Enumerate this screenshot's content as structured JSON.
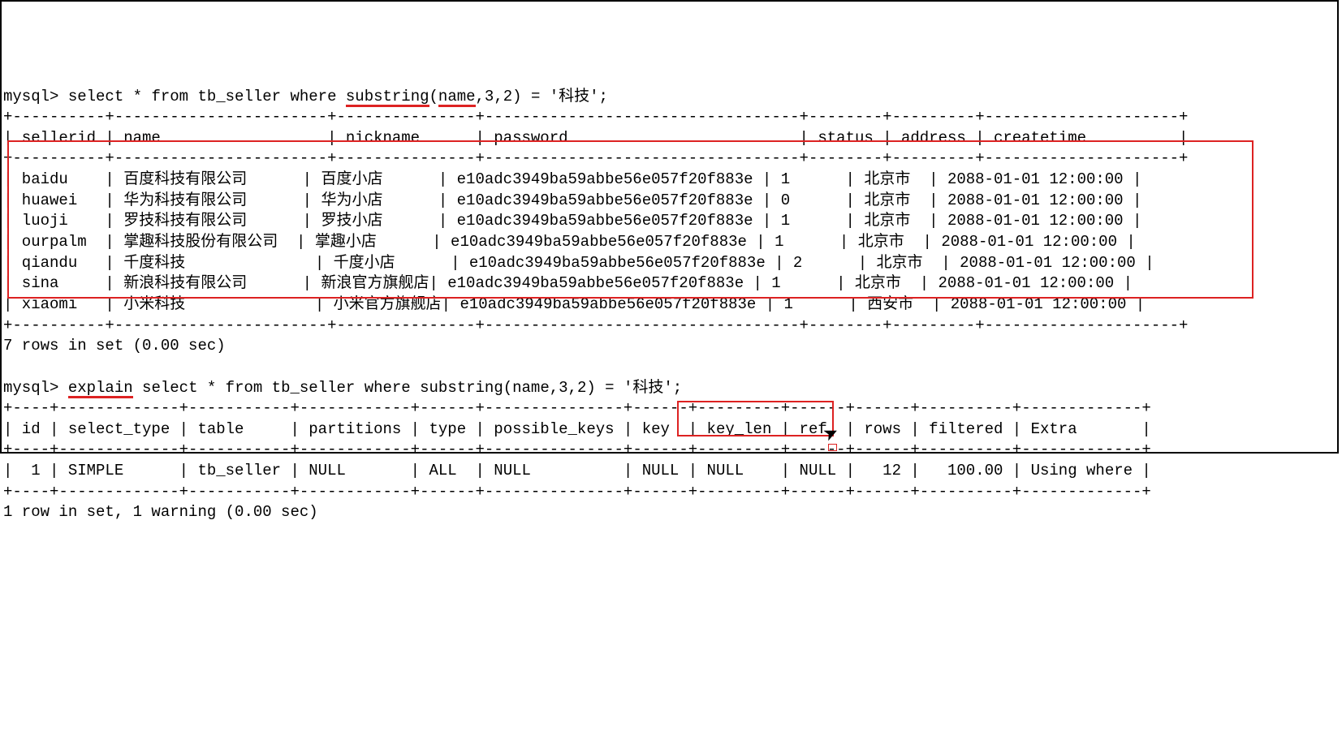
{
  "prompt": "mysql>",
  "query1": {
    "pre": " select * from tb_seller where ",
    "fn": "substring",
    "paren_open": "(",
    "arg1": "name",
    "rest": ",3,2) = '科技';"
  },
  "tbl1": {
    "sep": "+----------+-----------------------+---------------+----------------------------------+--------+---------+---------------------+",
    "header": "| sellerid | name                  | nickname      | password                         | status | address | createtime          |",
    "rows": [
      "| baidu    | 百度科技有限公司      | 百度小店      | e10adc3949ba59abbe56e057f20f883e | 1      | 北京市  | 2088-01-01 12:00:00 |",
      "| huawei   | 华为科技有限公司      | 华为小店      | e10adc3949ba59abbe56e057f20f883e | 0      | 北京市  | 2088-01-01 12:00:00 |",
      "| luoji    | 罗技科技有限公司      | 罗技小店      | e10adc3949ba59abbe56e057f20f883e | 1      | 北京市  | 2088-01-01 12:00:00 |",
      "| ourpalm  | 掌趣科技股份有限公司  | 掌趣小店      | e10adc3949ba59abbe56e057f20f883e | 1      | 北京市  | 2088-01-01 12:00:00 |",
      "| qiandu   | 千度科技              | 千度小店      | e10adc3949ba59abbe56e057f20f883e | 2      | 北京市  | 2088-01-01 12:00:00 |",
      "| sina     | 新浪科技有限公司      | 新浪官方旗舰店| e10adc3949ba59abbe56e057f20f883e | 1      | 北京市  | 2088-01-01 12:00:00 |",
      "| xiaomi   | 小米科技              | 小米官方旗舰店| e10adc3949ba59abbe56e057f20f883e | 1      | 西安市  | 2088-01-01 12:00:00 |"
    ]
  },
  "result1": "7 rows in set (0.00 sec)",
  "query2": {
    "pre": " ",
    "kw": "explain",
    "rest": " select * from tb_seller where substring(name,3,2) = '科技';"
  },
  "tbl2": {
    "sep": "+----+-------------+-----------+------------+------+---------------+------+---------+------+------+----------+-------------+",
    "header": "| id | select_type | table     | partitions | type | possible_keys | key  | key_len | ref  | rows | filtered | Extra       |",
    "row": "|  1 | SIMPLE      | tb_seller | NULL       | ALL  | NULL          | NULL | NULL    | NULL |   12 |   100.00 | Using where |"
  },
  "result2": "1 row in set, 1 warning (0.00 sec)"
}
